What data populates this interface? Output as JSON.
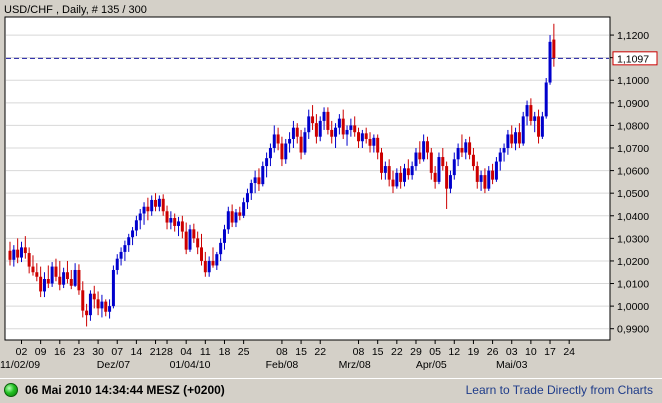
{
  "header": {
    "title": "USD/CHF , Daily, # 135 / 300"
  },
  "price_tag": "1,1097",
  "status": {
    "datetime": "06 Mai 2010 14:34:44  MESZ (+0200)",
    "link_text": "Learn to Trade Directly from Charts"
  },
  "colors": {
    "up": "#0000cc",
    "down": "#cc0000",
    "reference_line": "#1a1aa0",
    "background": "#ffffff",
    "grid": "#d8d8d8"
  },
  "icons": {
    "status": "status-light-icon"
  },
  "chart_data": {
    "type": "candlestick",
    "title": "USD/CHF , Daily, # 135 / 300",
    "ylim": [
      0.985,
      1.128
    ],
    "current_price": 1.1097,
    "y_ticks": [
      {
        "value": 1.12,
        "label": "1,1200"
      },
      {
        "value": 1.11,
        "label": "1,1100"
      },
      {
        "value": 1.1,
        "label": "1,1000"
      },
      {
        "value": 1.09,
        "label": "1,0900"
      },
      {
        "value": 1.08,
        "label": "1,0800"
      },
      {
        "value": 1.07,
        "label": "1,0700"
      },
      {
        "value": 1.06,
        "label": "1,0600"
      },
      {
        "value": 1.05,
        "label": "1,0500"
      },
      {
        "value": 1.04,
        "label": "1,0400"
      },
      {
        "value": 1.03,
        "label": "1,0300"
      },
      {
        "value": 1.02,
        "label": "1,0200"
      },
      {
        "value": 1.01,
        "label": "1,0100"
      },
      {
        "value": 1.0,
        "label": "1,0000"
      },
      {
        "value": 0.99,
        "label": "0,9900"
      }
    ],
    "x_ticks": [
      {
        "index": 3,
        "label": "02"
      },
      {
        "index": 8,
        "label": "09"
      },
      {
        "index": 13,
        "label": "16"
      },
      {
        "index": 18,
        "label": "23"
      },
      {
        "index": 23,
        "label": "30"
      },
      {
        "index": 28,
        "label": "07"
      },
      {
        "index": 33,
        "label": "14"
      },
      {
        "index": 38,
        "label": "21"
      },
      {
        "index": 41,
        "label": "28"
      },
      {
        "index": 46,
        "label": "04"
      },
      {
        "index": 51,
        "label": "11"
      },
      {
        "index": 56,
        "label": "18"
      },
      {
        "index": 61,
        "label": "25"
      },
      {
        "index": 71,
        "label": "08"
      },
      {
        "index": 76,
        "label": "15"
      },
      {
        "index": 81,
        "label": "22"
      },
      {
        "index": 91,
        "label": "08"
      },
      {
        "index": 96,
        "label": "15"
      },
      {
        "index": 101,
        "label": "22"
      },
      {
        "index": 106,
        "label": "29"
      },
      {
        "index": 111,
        "label": "05"
      },
      {
        "index": 116,
        "label": "12"
      },
      {
        "index": 121,
        "label": "19"
      },
      {
        "index": 126,
        "label": "26"
      },
      {
        "index": 131,
        "label": "03"
      },
      {
        "index": 136,
        "label": "10"
      },
      {
        "index": 141,
        "label": "17"
      },
      {
        "index": 146,
        "label": "24"
      }
    ],
    "date_labels": [
      {
        "index": 4,
        "label": "11/02/09"
      },
      {
        "index": 27,
        "label": "Dez/07"
      },
      {
        "index": 47,
        "label": "01/04/10"
      },
      {
        "index": 71,
        "label": "Feb/08"
      },
      {
        "index": 90,
        "label": "Mrz/08"
      },
      {
        "index": 110,
        "label": "Apr/05"
      },
      {
        "index": 131,
        "label": "Mai/03"
      }
    ],
    "candles": [
      {
        "o": 1.0245,
        "h": 1.0285,
        "l": 1.018,
        "c": 1.0205
      },
      {
        "o": 1.0205,
        "h": 1.027,
        "l": 1.0175,
        "c": 1.025
      },
      {
        "o": 1.025,
        "h": 1.03,
        "l": 1.019,
        "c": 1.0215
      },
      {
        "o": 1.0215,
        "h": 1.0285,
        "l": 1.0195,
        "c": 1.026
      },
      {
        "o": 1.026,
        "h": 1.031,
        "l": 1.021,
        "c": 1.0235
      },
      {
        "o": 1.0235,
        "h": 1.026,
        "l": 1.0145,
        "c": 1.0175
      },
      {
        "o": 1.0175,
        "h": 1.0225,
        "l": 1.0135,
        "c": 1.015
      },
      {
        "o": 1.015,
        "h": 1.019,
        "l": 1.011,
        "c": 1.013
      },
      {
        "o": 1.013,
        "h": 1.0175,
        "l": 1.004,
        "c": 1.0065
      },
      {
        "o": 1.0065,
        "h": 1.015,
        "l": 1.004,
        "c": 1.012
      },
      {
        "o": 1.012,
        "h": 1.018,
        "l": 1.008,
        "c": 1.01
      },
      {
        "o": 1.01,
        "h": 1.0195,
        "l": 1.0085,
        "c": 1.0175
      },
      {
        "o": 1.0175,
        "h": 1.021,
        "l": 1.011,
        "c": 1.013
      },
      {
        "o": 1.013,
        "h": 1.02,
        "l": 1.007,
        "c": 1.0095
      },
      {
        "o": 1.0095,
        "h": 1.017,
        "l": 1.008,
        "c": 1.015
      },
      {
        "o": 1.015,
        "h": 1.02,
        "l": 1.01,
        "c": 1.012
      },
      {
        "o": 1.012,
        "h": 1.016,
        "l": 1.0075,
        "c": 1.009
      },
      {
        "o": 1.009,
        "h": 1.019,
        "l": 1.0085,
        "c": 1.016
      },
      {
        "o": 1.016,
        "h": 1.0185,
        "l": 1.005,
        "c": 1.007
      },
      {
        "o": 1.007,
        "h": 1.011,
        "l": 0.995,
        "c": 0.998
      },
      {
        "o": 0.998,
        "h": 1.001,
        "l": 0.991,
        "c": 0.996
      },
      {
        "o": 0.996,
        "h": 1.007,
        "l": 0.9935,
        "c": 1.0055
      },
      {
        "o": 1.0055,
        "h": 1.009,
        "l": 0.999,
        "c": 1.003
      },
      {
        "o": 1.003,
        "h": 1.0065,
        "l": 0.996,
        "c": 0.999
      },
      {
        "o": 0.999,
        "h": 1.005,
        "l": 0.995,
        "c": 1.002
      },
      {
        "o": 1.002,
        "h": 1.003,
        "l": 0.9955,
        "c": 0.9975
      },
      {
        "o": 0.9975,
        "h": 1.003,
        "l": 0.9945,
        "c": 1.0
      },
      {
        "o": 1.0,
        "h": 1.018,
        "l": 0.999,
        "c": 1.016
      },
      {
        "o": 1.016,
        "h": 1.023,
        "l": 1.014,
        "c": 1.021
      },
      {
        "o": 1.021,
        "h": 1.026,
        "l": 1.018,
        "c": 1.024
      },
      {
        "o": 1.024,
        "h": 1.029,
        "l": 1.02,
        "c": 1.027
      },
      {
        "o": 1.027,
        "h": 1.032,
        "l": 1.024,
        "c": 1.0305
      },
      {
        "o": 1.0305,
        "h": 1.035,
        "l": 1.027,
        "c": 1.0335
      },
      {
        "o": 1.0335,
        "h": 1.04,
        "l": 1.031,
        "c": 1.038
      },
      {
        "o": 1.038,
        "h": 1.043,
        "l": 1.034,
        "c": 1.041
      },
      {
        "o": 1.041,
        "h": 1.046,
        "l": 1.036,
        "c": 1.044
      },
      {
        "o": 1.044,
        "h": 1.048,
        "l": 1.038,
        "c": 1.042
      },
      {
        "o": 1.042,
        "h": 1.049,
        "l": 1.04,
        "c": 1.047
      },
      {
        "o": 1.047,
        "h": 1.05,
        "l": 1.042,
        "c": 1.044
      },
      {
        "o": 1.044,
        "h": 1.049,
        "l": 1.042,
        "c": 1.0475
      },
      {
        "o": 1.0475,
        "h": 1.0495,
        "l": 1.04,
        "c": 1.042
      },
      {
        "o": 1.042,
        "h": 1.0445,
        "l": 1.034,
        "c": 1.037
      },
      {
        "o": 1.037,
        "h": 1.042,
        "l": 1.034,
        "c": 1.039
      },
      {
        "o": 1.039,
        "h": 1.041,
        "l": 1.033,
        "c": 1.0355
      },
      {
        "o": 1.0355,
        "h": 1.0395,
        "l": 1.031,
        "c": 1.0375
      },
      {
        "o": 1.0375,
        "h": 1.04,
        "l": 1.03,
        "c": 1.033
      },
      {
        "o": 1.033,
        "h": 1.037,
        "l": 1.023,
        "c": 1.025
      },
      {
        "o": 1.025,
        "h": 1.036,
        "l": 1.024,
        "c": 1.034
      },
      {
        "o": 1.034,
        "h": 1.0365,
        "l": 1.028,
        "c": 1.03
      },
      {
        "o": 1.03,
        "h": 1.033,
        "l": 1.023,
        "c": 1.026
      },
      {
        "o": 1.026,
        "h": 1.032,
        "l": 1.018,
        "c": 1.02
      },
      {
        "o": 1.02,
        "h": 1.024,
        "l": 1.013,
        "c": 1.015
      },
      {
        "o": 1.015,
        "h": 1.022,
        "l": 1.013,
        "c": 1.02
      },
      {
        "o": 1.02,
        "h": 1.026,
        "l": 1.017,
        "c": 1.018
      },
      {
        "o": 1.018,
        "h": 1.024,
        "l": 1.016,
        "c": 1.023
      },
      {
        "o": 1.023,
        "h": 1.03,
        "l": 1.02,
        "c": 1.028
      },
      {
        "o": 1.028,
        "h": 1.036,
        "l": 1.025,
        "c": 1.034
      },
      {
        "o": 1.034,
        "h": 1.044,
        "l": 1.032,
        "c": 1.042
      },
      {
        "o": 1.042,
        "h": 1.045,
        "l": 1.035,
        "c": 1.037
      },
      {
        "o": 1.037,
        "h": 1.043,
        "l": 1.035,
        "c": 1.0415
      },
      {
        "o": 1.0415,
        "h": 1.044,
        "l": 1.038,
        "c": 1.04
      },
      {
        "o": 1.04,
        "h": 1.048,
        "l": 1.039,
        "c": 1.046
      },
      {
        "o": 1.046,
        "h": 1.052,
        "l": 1.043,
        "c": 1.05
      },
      {
        "o": 1.05,
        "h": 1.056,
        "l": 1.047,
        "c": 1.0545
      },
      {
        "o": 1.0545,
        "h": 1.06,
        "l": 1.05,
        "c": 1.057
      },
      {
        "o": 1.057,
        "h": 1.061,
        "l": 1.051,
        "c": 1.054
      },
      {
        "o": 1.054,
        "h": 1.064,
        "l": 1.053,
        "c": 1.062
      },
      {
        "o": 1.062,
        "h": 1.068,
        "l": 1.057,
        "c": 1.0655
      },
      {
        "o": 1.0655,
        "h": 1.072,
        "l": 1.062,
        "c": 1.07
      },
      {
        "o": 1.07,
        "h": 1.08,
        "l": 1.068,
        "c": 1.076
      },
      {
        "o": 1.076,
        "h": 1.079,
        "l": 1.069,
        "c": 1.072
      },
      {
        "o": 1.072,
        "h": 1.075,
        "l": 1.062,
        "c": 1.065
      },
      {
        "o": 1.065,
        "h": 1.074,
        "l": 1.063,
        "c": 1.072
      },
      {
        "o": 1.072,
        "h": 1.077,
        "l": 1.068,
        "c": 1.074
      },
      {
        "o": 1.074,
        "h": 1.082,
        "l": 1.07,
        "c": 1.079
      },
      {
        "o": 1.079,
        "h": 1.081,
        "l": 1.072,
        "c": 1.075
      },
      {
        "o": 1.075,
        "h": 1.078,
        "l": 1.065,
        "c": 1.068
      },
      {
        "o": 1.068,
        "h": 1.079,
        "l": 1.067,
        "c": 1.077
      },
      {
        "o": 1.077,
        "h": 1.087,
        "l": 1.074,
        "c": 1.084
      },
      {
        "o": 1.084,
        "h": 1.089,
        "l": 1.078,
        "c": 1.081
      },
      {
        "o": 1.081,
        "h": 1.085,
        "l": 1.072,
        "c": 1.075
      },
      {
        "o": 1.075,
        "h": 1.084,
        "l": 1.073,
        "c": 1.082
      },
      {
        "o": 1.082,
        "h": 1.088,
        "l": 1.078,
        "c": 1.086
      },
      {
        "o": 1.086,
        "h": 1.088,
        "l": 1.076,
        "c": 1.078
      },
      {
        "o": 1.078,
        "h": 1.082,
        "l": 1.072,
        "c": 1.075
      },
      {
        "o": 1.075,
        "h": 1.081,
        "l": 1.07,
        "c": 1.079
      },
      {
        "o": 1.079,
        "h": 1.085,
        "l": 1.076,
        "c": 1.083
      },
      {
        "o": 1.083,
        "h": 1.087,
        "l": 1.074,
        "c": 1.076
      },
      {
        "o": 1.076,
        "h": 1.08,
        "l": 1.071,
        "c": 1.078
      },
      {
        "o": 1.078,
        "h": 1.083,
        "l": 1.075,
        "c": 1.08
      },
      {
        "o": 1.08,
        "h": 1.084,
        "l": 1.075,
        "c": 1.077
      },
      {
        "o": 1.077,
        "h": 1.079,
        "l": 1.07,
        "c": 1.073
      },
      {
        "o": 1.073,
        "h": 1.078,
        "l": 1.07,
        "c": 1.0765
      },
      {
        "o": 1.0765,
        "h": 1.079,
        "l": 1.072,
        "c": 1.074
      },
      {
        "o": 1.074,
        "h": 1.077,
        "l": 1.068,
        "c": 1.071
      },
      {
        "o": 1.071,
        "h": 1.076,
        "l": 1.068,
        "c": 1.0745
      },
      {
        "o": 1.0745,
        "h": 1.076,
        "l": 1.065,
        "c": 1.068
      },
      {
        "o": 1.068,
        "h": 1.07,
        "l": 1.056,
        "c": 1.059
      },
      {
        "o": 1.059,
        "h": 1.064,
        "l": 1.056,
        "c": 1.062
      },
      {
        "o": 1.062,
        "h": 1.065,
        "l": 1.053,
        "c": 1.056
      },
      {
        "o": 1.056,
        "h": 1.06,
        "l": 1.05,
        "c": 1.053
      },
      {
        "o": 1.053,
        "h": 1.061,
        "l": 1.052,
        "c": 1.059
      },
      {
        "o": 1.059,
        "h": 1.062,
        "l": 1.052,
        "c": 1.055
      },
      {
        "o": 1.055,
        "h": 1.063,
        "l": 1.053,
        "c": 1.061
      },
      {
        "o": 1.061,
        "h": 1.065,
        "l": 1.056,
        "c": 1.058
      },
      {
        "o": 1.058,
        "h": 1.064,
        "l": 1.056,
        "c": 1.062
      },
      {
        "o": 1.062,
        "h": 1.07,
        "l": 1.06,
        "c": 1.068
      },
      {
        "o": 1.068,
        "h": 1.073,
        "l": 1.063,
        "c": 1.065
      },
      {
        "o": 1.065,
        "h": 1.076,
        "l": 1.064,
        "c": 1.073
      },
      {
        "o": 1.073,
        "h": 1.075,
        "l": 1.065,
        "c": 1.068
      },
      {
        "o": 1.068,
        "h": 1.07,
        "l": 1.056,
        "c": 1.059
      },
      {
        "o": 1.059,
        "h": 1.062,
        "l": 1.052,
        "c": 1.055
      },
      {
        "o": 1.055,
        "h": 1.068,
        "l": 1.054,
        "c": 1.066
      },
      {
        "o": 1.066,
        "h": 1.07,
        "l": 1.06,
        "c": 1.062
      },
      {
        "o": 1.062,
        "h": 1.064,
        "l": 1.043,
        "c": 1.052
      },
      {
        "o": 1.052,
        "h": 1.06,
        "l": 1.05,
        "c": 1.058
      },
      {
        "o": 1.058,
        "h": 1.068,
        "l": 1.056,
        "c": 1.065
      },
      {
        "o": 1.065,
        "h": 1.072,
        "l": 1.062,
        "c": 1.07
      },
      {
        "o": 1.07,
        "h": 1.076,
        "l": 1.066,
        "c": 1.068
      },
      {
        "o": 1.068,
        "h": 1.074,
        "l": 1.065,
        "c": 1.0725
      },
      {
        "o": 1.0725,
        "h": 1.075,
        "l": 1.065,
        "c": 1.067
      },
      {
        "o": 1.067,
        "h": 1.07,
        "l": 1.06,
        "c": 1.062
      },
      {
        "o": 1.062,
        "h": 1.064,
        "l": 1.052,
        "c": 1.055
      },
      {
        "o": 1.055,
        "h": 1.06,
        "l": 1.051,
        "c": 1.058
      },
      {
        "o": 1.058,
        "h": 1.061,
        "l": 1.05,
        "c": 1.052
      },
      {
        "o": 1.052,
        "h": 1.062,
        "l": 1.051,
        "c": 1.06
      },
      {
        "o": 1.06,
        "h": 1.063,
        "l": 1.054,
        "c": 1.056
      },
      {
        "o": 1.056,
        "h": 1.066,
        "l": 1.055,
        "c": 1.064
      },
      {
        "o": 1.064,
        "h": 1.07,
        "l": 1.06,
        "c": 1.068
      },
      {
        "o": 1.068,
        "h": 1.072,
        "l": 1.064,
        "c": 1.07
      },
      {
        "o": 1.07,
        "h": 1.078,
        "l": 1.067,
        "c": 1.076
      },
      {
        "o": 1.076,
        "h": 1.08,
        "l": 1.07,
        "c": 1.072
      },
      {
        "o": 1.072,
        "h": 1.079,
        "l": 1.069,
        "c": 1.077
      },
      {
        "o": 1.077,
        "h": 1.081,
        "l": 1.07,
        "c": 1.072
      },
      {
        "o": 1.072,
        "h": 1.086,
        "l": 1.071,
        "c": 1.084
      },
      {
        "o": 1.084,
        "h": 1.091,
        "l": 1.08,
        "c": 1.089
      },
      {
        "o": 1.089,
        "h": 1.092,
        "l": 1.08,
        "c": 1.082
      },
      {
        "o": 1.082,
        "h": 1.086,
        "l": 1.077,
        "c": 1.084
      },
      {
        "o": 1.084,
        "h": 1.087,
        "l": 1.072,
        "c": 1.075
      },
      {
        "o": 1.075,
        "h": 1.086,
        "l": 1.074,
        "c": 1.084
      },
      {
        "o": 1.084,
        "h": 1.101,
        "l": 1.083,
        "c": 1.099
      },
      {
        "o": 1.099,
        "h": 1.12,
        "l": 1.098,
        "c": 1.117
      },
      {
        "o": 1.118,
        "h": 1.125,
        "l": 1.106,
        "c": 1.1097
      }
    ]
  }
}
